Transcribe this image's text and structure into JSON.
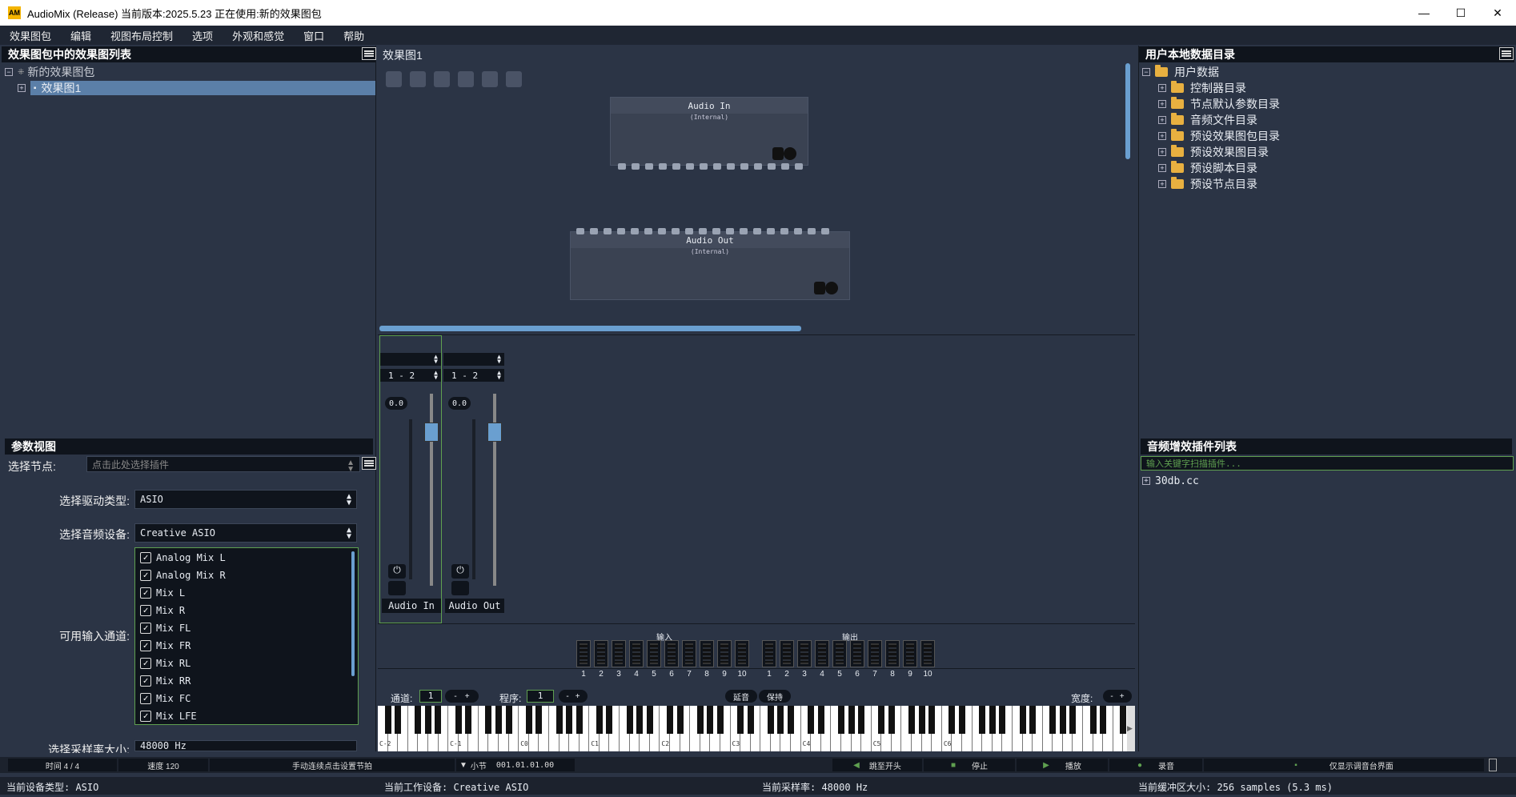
{
  "window": {
    "logo": "AM",
    "title": "AudioMix (Release) 当前版本:2025.5.23 正在使用:新的效果图包",
    "min": "—",
    "max": "☐",
    "close": "✕"
  },
  "menu": [
    "效果图包",
    "编辑",
    "视图布局控制",
    "选项",
    "外观和感觉",
    "窗口",
    "帮助"
  ],
  "left": {
    "title": "效果图包中的效果图列表",
    "root_label": "新的效果图包",
    "child_label": "效果图1",
    "param_title": "参数视图",
    "select_node_label": "选择节点:",
    "select_node_placeholder": "点击此处选择插件",
    "driver_label": "选择驱动类型:",
    "driver_value": "ASIO",
    "device_label": "选择音频设备:",
    "device_value": "Creative ASIO",
    "channels_label": "可用输入通道:",
    "channels": [
      "Analog Mix L",
      "Analog Mix R",
      "Mix L",
      "Mix R",
      "Mix FL",
      "Mix FR",
      "Mix RL",
      "Mix RR",
      "Mix FC",
      "Mix LFE"
    ],
    "samplerate_label": "选择采样率大小:",
    "samplerate_value": "48000 Hz"
  },
  "center": {
    "title": "效果图1",
    "node_in": {
      "name": "Audio In",
      "sub": "(Internal)"
    },
    "node_out": {
      "name": "Audio Out",
      "sub": "(Internal)"
    },
    "strips": [
      {
        "range": "1 - 2",
        "gain": "0.0",
        "name": "Audio In"
      },
      {
        "range": "1 - 2",
        "gain": "0.0",
        "name": "Audio Out"
      }
    ],
    "meters_in_label": "输入",
    "meters_out_label": "输出",
    "meter_numbers": [
      "1",
      "2",
      "3",
      "4",
      "5",
      "6",
      "7",
      "8",
      "9",
      "10"
    ],
    "channel_label": "通道:",
    "channel_value": "1",
    "program_label": "程序:",
    "program_value": "1",
    "minus": "-",
    "plus": "+",
    "sustain": "延音",
    "hold": "保持",
    "width_label": "宽度:",
    "octaves": [
      "C-2",
      "C-1",
      "C0",
      "C1",
      "C2",
      "C3",
      "C4",
      "C5",
      "C6"
    ]
  },
  "right": {
    "title": "用户本地数据目录",
    "root": "用户数据",
    "items": [
      "控制器目录",
      "节点默认参数目录",
      "音频文件目录",
      "预设效果图包目录",
      "预设效果图目录",
      "预设脚本目录",
      "预设节点目录"
    ],
    "plugins_title": "音频增效插件列表",
    "plugin_search_placeholder": "输入关键字扫描插件...",
    "plugin_items": [
      "30db.cc"
    ]
  },
  "transport": {
    "time": "时间 4 / 4",
    "tempo": "速度 120",
    "tap": "手动连续点击设置节拍",
    "bar_label": "小节",
    "position": "001.01.01.00",
    "goto_start": "跳至开头",
    "stop": "停止",
    "play": "播放",
    "record": "录音",
    "mixer_only": "仅显示调音台界面"
  },
  "status": {
    "device_type": "当前设备类型:  ASIO",
    "device": "当前工作设备: Creative ASIO",
    "samplerate": "当前采样率:  48000 Hz",
    "buffer": "当前缓冲区大小: 256 samples (5.3 ms)"
  },
  "colors": {
    "accent": "#6a9fd0",
    "bg": "#2b3445",
    "dark": "#0f141c",
    "selection": "#5b7fa8",
    "green": "#5fa050"
  }
}
